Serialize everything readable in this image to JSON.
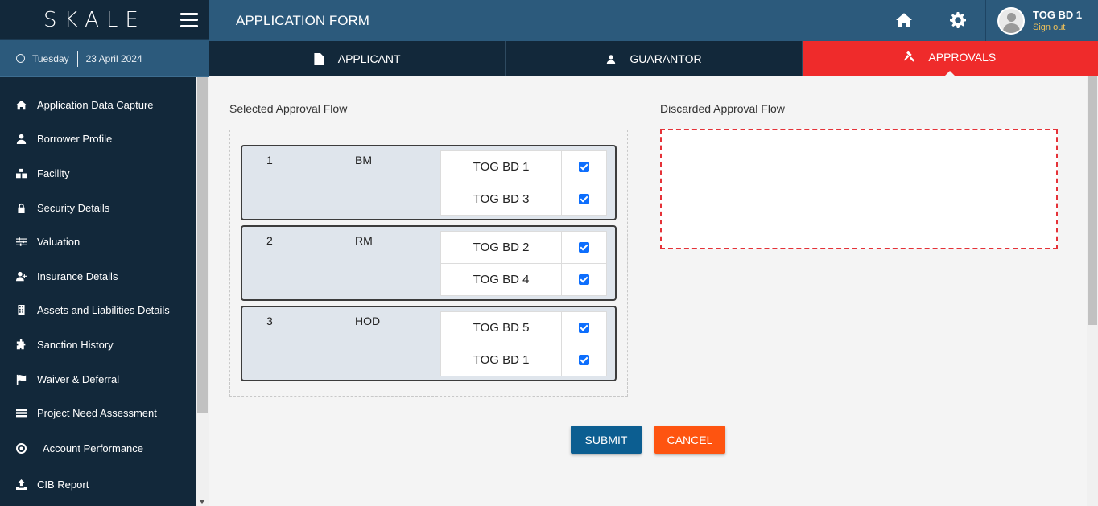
{
  "app": {
    "logo": "SKALE"
  },
  "date": {
    "day": "Tuesday",
    "date": "23 April 2024"
  },
  "header": {
    "title": "APPLICATION FORM"
  },
  "user": {
    "name": "TOG BD 1",
    "signout": "Sign out"
  },
  "sidebar": {
    "items": [
      {
        "label": "Application Data Capture",
        "icon": "home-icon"
      },
      {
        "label": "Borrower Profile",
        "icon": "user-icon"
      },
      {
        "label": "Facility",
        "icon": "cubes-icon"
      },
      {
        "label": "Security Details",
        "icon": "shield-icon"
      },
      {
        "label": "Valuation",
        "icon": "sliders-icon"
      },
      {
        "label": "Insurance Details",
        "icon": "user-plus-icon"
      },
      {
        "label": "Assets and Liabilities Details",
        "icon": "building-icon"
      },
      {
        "label": "Sanction History",
        "icon": "puzzle-icon"
      },
      {
        "label": "Waiver & Deferral",
        "icon": "flag-icon"
      },
      {
        "label": "Project Need Assessment",
        "icon": "list-icon"
      },
      {
        "label": "Account Performance",
        "icon": "target-icon"
      },
      {
        "label": "CIB Report",
        "icon": "upload-icon"
      }
    ]
  },
  "tabs": [
    {
      "label": "APPLICANT",
      "icon": "file-icon",
      "active": false
    },
    {
      "label": "GUARANTOR",
      "icon": "user-icon",
      "active": false
    },
    {
      "label": "APPROVALS",
      "icon": "gavel-icon",
      "active": true
    }
  ],
  "approvals": {
    "selected_label": "Selected Approval Flow",
    "discarded_label": "Discarded Approval Flow",
    "flows": [
      {
        "num": "1",
        "role": "BM",
        "approvers": [
          {
            "name": "TOG BD 1",
            "checked": true
          },
          {
            "name": "TOG BD 3",
            "checked": true
          }
        ]
      },
      {
        "num": "2",
        "role": "RM",
        "approvers": [
          {
            "name": "TOG BD 2",
            "checked": true
          },
          {
            "name": "TOG BD 4",
            "checked": true
          }
        ]
      },
      {
        "num": "3",
        "role": "HOD",
        "approvers": [
          {
            "name": "TOG BD 5",
            "checked": true
          },
          {
            "name": "TOG BD 1",
            "checked": true
          }
        ]
      }
    ]
  },
  "buttons": {
    "submit": "SUBMIT",
    "cancel": "CANCEL"
  },
  "colors": {
    "accent_red": "#ef2b2b",
    "nav_dark": "#12283a",
    "header_blue": "#2c5a7c",
    "submit_blue": "#0c5e91",
    "cancel_orange": "#fe5410",
    "checkbox_blue": "#0d6efd"
  }
}
